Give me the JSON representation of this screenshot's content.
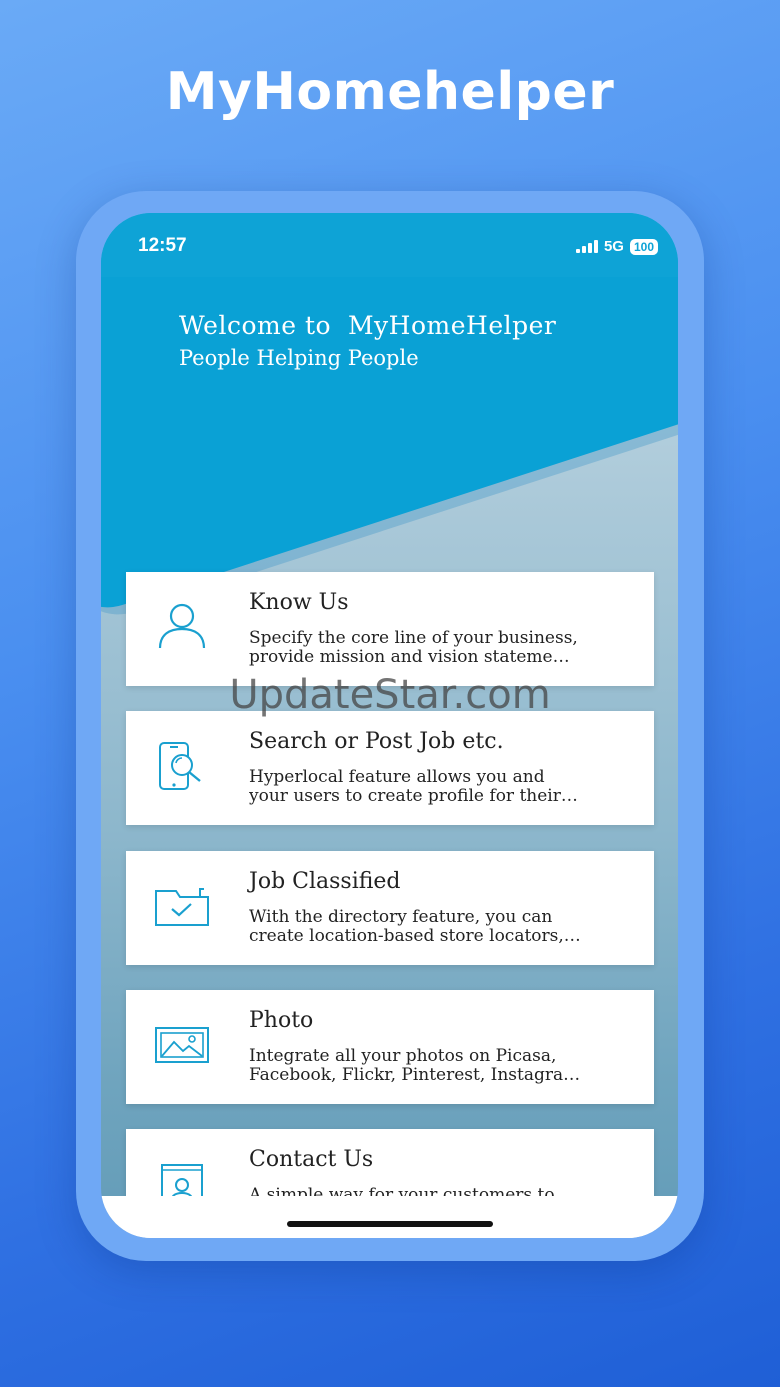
{
  "app_title": "MyHomehelper",
  "watermark": "UpdateStar.com",
  "status_bar": {
    "time": "12:57",
    "network": "5G",
    "battery": "100"
  },
  "banner": {
    "title": "Welcome to  MyHomeHelper",
    "subtitle": "People Helping People"
  },
  "cards": [
    {
      "title": "Know Us",
      "line1": "Specify the core line of your business,",
      "line2": "provide mission and vision stateme…",
      "icon": "user-icon"
    },
    {
      "title": "Search or Post Job etc.",
      "line1": "Hyperlocal feature allows you and",
      "line2": "your users to create profile for their…",
      "icon": "phone-search-icon"
    },
    {
      "title": "Job Classified",
      "line1": "With the directory feature, you can",
      "line2": "create location-based store locators,…",
      "icon": "folder-check-icon"
    },
    {
      "title": "Photo",
      "line1": "Integrate all your photos on Picasa,",
      "line2": "Facebook, Flickr, Pinterest, Instagra…",
      "icon": "image-icon"
    },
    {
      "title": "Contact Us",
      "line1": "A simple way for your customers to",
      "line2": "",
      "icon": "contact-book-icon"
    }
  ],
  "colors": {
    "accent": "#0aa1d5",
    "icon": "#1aa0cf",
    "background": "#4a8ff0"
  }
}
